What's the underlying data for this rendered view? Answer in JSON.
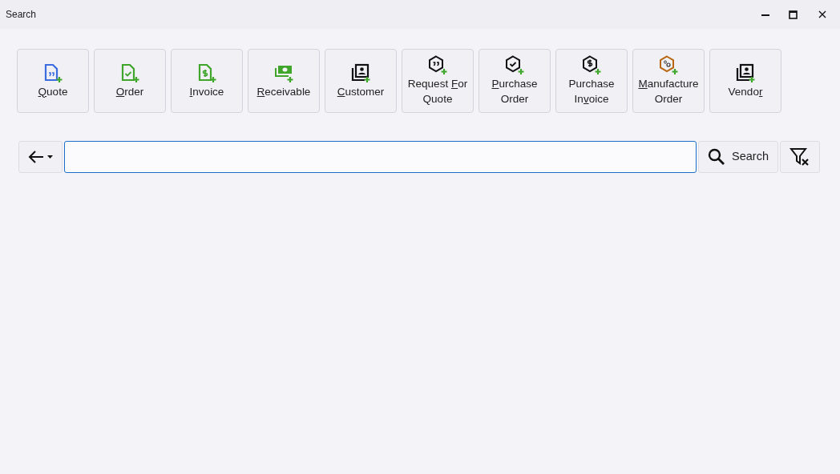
{
  "window": {
    "title": "Search"
  },
  "toolbar": [
    {
      "kind": "doc-quote",
      "lines": [
        [
          {
            "text": "Q",
            "underline": true
          },
          {
            "text": "uote",
            "underline": false
          }
        ]
      ]
    },
    {
      "kind": "doc-check",
      "lines": [
        [
          {
            "text": "O",
            "underline": true
          },
          {
            "text": "rder",
            "underline": false
          }
        ]
      ]
    },
    {
      "kind": "doc-dollar",
      "lines": [
        [
          {
            "text": "I",
            "underline": true
          },
          {
            "text": "nvoice",
            "underline": false
          }
        ]
      ]
    },
    {
      "kind": "money",
      "lines": [
        [
          {
            "text": "R",
            "underline": true
          },
          {
            "text": "eceivable",
            "underline": false
          }
        ]
      ]
    },
    {
      "kind": "contact",
      "lines": [
        [
          {
            "text": "C",
            "underline": true
          },
          {
            "text": "ustomer",
            "underline": false
          }
        ]
      ]
    },
    {
      "kind": "hex-quote",
      "lines": [
        [
          {
            "text": "Request ",
            "underline": false
          },
          {
            "text": "F",
            "underline": true
          },
          {
            "text": "or",
            "underline": false
          }
        ],
        [
          {
            "text": "Quote",
            "underline": false
          }
        ]
      ]
    },
    {
      "kind": "hex-check",
      "lines": [
        [
          {
            "text": "P",
            "underline": true
          },
          {
            "text": "urchase",
            "underline": false
          }
        ],
        [
          {
            "text": "Order",
            "underline": false
          }
        ]
      ]
    },
    {
      "kind": "hex-dollar",
      "lines": [
        [
          {
            "text": "Purchase",
            "underline": false
          }
        ],
        [
          {
            "text": "In",
            "underline": false
          },
          {
            "text": "v",
            "underline": true
          },
          {
            "text": "oice",
            "underline": false
          }
        ]
      ]
    },
    {
      "kind": "hex-gears",
      "lines": [
        [
          {
            "text": "M",
            "underline": true
          },
          {
            "text": "anufacture",
            "underline": false
          }
        ],
        [
          {
            "text": "Order",
            "underline": false
          }
        ]
      ]
    },
    {
      "kind": "contact",
      "lines": [
        [
          {
            "text": "Vendo",
            "underline": false
          },
          {
            "text": "r",
            "underline": true
          }
        ]
      ]
    }
  ],
  "search": {
    "button": "Search"
  }
}
